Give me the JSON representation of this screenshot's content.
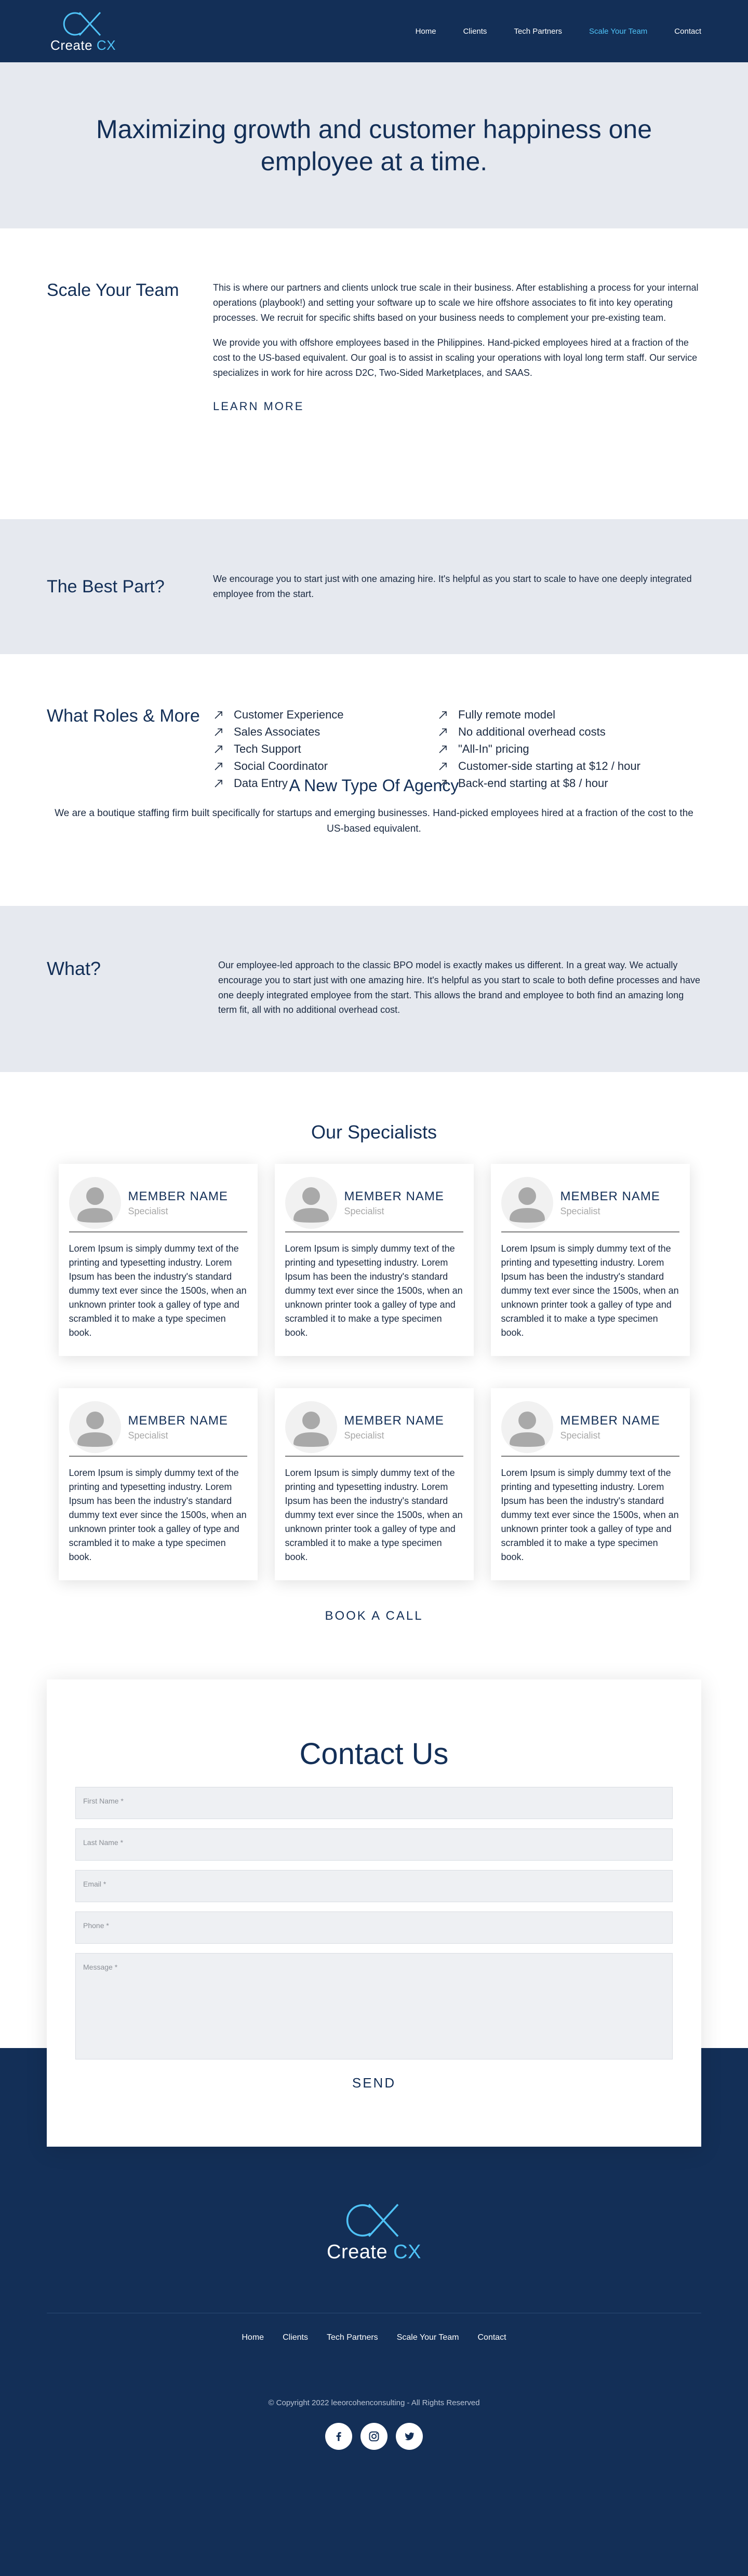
{
  "header": {
    "logo_main": "Create ",
    "logo_accent": "CX",
    "nav": [
      "Home",
      "Clients",
      "Tech Partners",
      "Scale Your Team",
      "Contact"
    ],
    "active_nav": "Scale Your Team"
  },
  "hero": {
    "title": "Maximizing growth and customer happiness one employee at a time."
  },
  "scale": {
    "heading": "Scale Your Team",
    "paragraph1": "This is where our partners and clients unlock true scale in their business. After establishing a process for your internal operations (playbook!) and setting your software up to scale we hire offshore associates to fit into key operating processes. We recruit for specific shifts based on your business needs to complement your pre-existing team.",
    "paragraph2": "We provide you with offshore employees based in the Philippines. Hand-picked employees hired at a fraction of the cost to the US-based equivalent. Our goal is to assist in scaling your operations with loyal long term staff. Our service specializes in work for hire across D2C, Two-Sided Marketplaces, and SAAS.",
    "learn_more": "LEARN MORE"
  },
  "best_part": {
    "heading": "The Best Part?",
    "text": "We  encourage you to start just with one amazing hire. It's helpful as you start to scale to have one deeply integrated employee from the start."
  },
  "roles": {
    "heading": "What Roles & More",
    "left": [
      "Customer Experience",
      "Sales Associates",
      "Tech Support",
      "Social Coordinator",
      "Data Entry"
    ],
    "right": [
      "Fully remote model",
      "No additional overhead costs",
      "\"All-In\" pricing",
      "Customer-side starting at $12 / hour",
      "Back-end starting at $8 / hour"
    ]
  },
  "agency": {
    "heading": "A New Type Of Agency",
    "text": "We are a boutique staffing firm built specifically for startups and emerging businesses. Hand-picked employees hired at a fraction of the cost to the US-based equivalent."
  },
  "what": {
    "heading": "What?",
    "text": "Our employee-led approach to the classic BPO model is exactly makes us different. In a great way. We actually encourage you to start just with one amazing hire. It's helpful as you start to scale to both define processes and have one deeply integrated employee from the start. This allows the brand and employee to both find an amazing long term fit, all with no additional overhead cost."
  },
  "specialists": {
    "heading": "Our Specialists",
    "members": [
      {
        "name": "MEMBER NAME",
        "role": "Specialist",
        "bio": "Lorem Ipsum is simply dummy text of the printing and typesetting industry. Lorem Ipsum has been the industry's standard dummy text ever since the 1500s, when an unknown printer took a galley of type and scrambled it to make a type specimen book."
      },
      {
        "name": "MEMBER NAME",
        "role": "Specialist",
        "bio": "Lorem Ipsum is simply dummy text of the printing and typesetting industry. Lorem Ipsum has been the industry's standard dummy text ever since the 1500s, when an unknown printer took a galley of type and scrambled it to make a type specimen book."
      },
      {
        "name": "MEMBER NAME",
        "role": "Specialist",
        "bio": "Lorem Ipsum is simply dummy text of the printing and typesetting industry. Lorem Ipsum has been the industry's standard dummy text ever since the 1500s, when an unknown printer took a galley of type and scrambled it to make a type specimen book."
      },
      {
        "name": "MEMBER NAME",
        "role": "Specialist",
        "bio": "Lorem Ipsum is simply dummy text of the printing and typesetting industry. Lorem Ipsum has been the industry's standard dummy text ever since the 1500s, when an unknown printer took a galley of type and scrambled it to make a type specimen book."
      },
      {
        "name": "MEMBER NAME",
        "role": "Specialist",
        "bio": "Lorem Ipsum is simply dummy text of the printing and typesetting industry. Lorem Ipsum has been the industry's standard dummy text ever since the 1500s, when an unknown printer took a galley of type and scrambled it to make a type specimen book."
      },
      {
        "name": "MEMBER NAME",
        "role": "Specialist",
        "bio": "Lorem Ipsum is simply dummy text of the printing and typesetting industry. Lorem Ipsum has been the industry's standard dummy text ever since the 1500s, when an unknown printer took a galley of type and scrambled it to make a type specimen book."
      }
    ],
    "book_call": "BOOK A CALL"
  },
  "contact": {
    "heading": "Contact Us",
    "first_name_placeholder": "First Name *",
    "last_name_placeholder": "Last Name *",
    "email_placeholder": "Email *",
    "phone_placeholder": "Phone *",
    "message_placeholder": "Message *",
    "send": "SEND"
  },
  "footer": {
    "logo_main": "Create ",
    "logo_accent": "CX",
    "nav": [
      "Home",
      "Clients",
      "Tech Partners",
      "Scale Your Team",
      "Contact"
    ],
    "copyright": "© Copyright 2022 leeorcohenconsulting - All Rights Reserved",
    "socials": [
      "facebook-icon",
      "instagram-icon",
      "twitter-icon"
    ]
  },
  "colors": {
    "navy": "#132f57",
    "accent": "#4fc3f7",
    "light_band": "#e6e9ef"
  }
}
